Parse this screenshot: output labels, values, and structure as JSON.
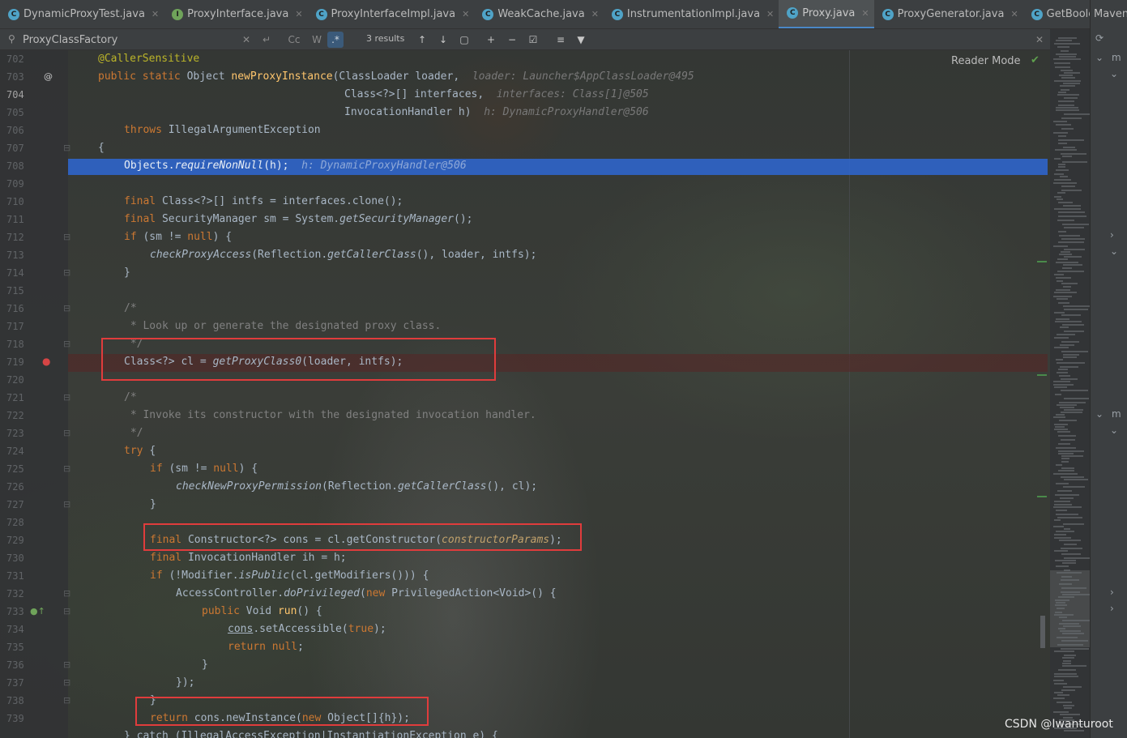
{
  "tabs": [
    {
      "label": "DynamicProxyTest.java",
      "icon": "class-file-icon",
      "active": false
    },
    {
      "label": "ProxyInterface.java",
      "icon": "interface-file-icon",
      "active": false
    },
    {
      "label": "ProxyInterfaceImpl.java",
      "icon": "class-file-icon",
      "active": false
    },
    {
      "label": "WeakCache.java",
      "icon": "class-file-icon",
      "active": false
    },
    {
      "label": "InstrumentationImpl.java",
      "icon": "class-file-icon",
      "active": false
    },
    {
      "label": "Proxy.java",
      "icon": "class-file-icon",
      "active": true
    },
    {
      "label": "ProxyGenerator.java",
      "icon": "class-file-icon",
      "active": false
    },
    {
      "label": "GetBooleanAction.java",
      "icon": "class-file-icon",
      "active": false
    }
  ],
  "right_panel": {
    "label": "Maven"
  },
  "search": {
    "value": "ProxyClassFactory",
    "results": "3 results",
    "regex_label": ".*",
    "case_label": "Cc"
  },
  "reader_mode": "Reader Mode",
  "line_numbers": [
    "702",
    "703",
    "704",
    "705",
    "706",
    "707",
    "708",
    "709",
    "710",
    "711",
    "712",
    "713",
    "714",
    "715",
    "716",
    "717",
    "718",
    "719",
    "720",
    "721",
    "722",
    "723",
    "724",
    "725",
    "726",
    "727",
    "728",
    "729",
    "730",
    "731",
    "732",
    "733",
    "734",
    "735",
    "736",
    "737",
    "738",
    "739"
  ],
  "current_line": "704",
  "code": {
    "l702": "@CallerSensitive",
    "l703_a": "public static ",
    "l703_b": "Object ",
    "l703_c": "newProxyInstance",
    "l703_d": "(ClassLoader loader,",
    "l703_hint": "loader: Launcher$AppClassLoader@495",
    "l704_a": "Class<?>[] interfaces,",
    "l704_hint": "interfaces: Class[1]@505",
    "l705_a": "InvocationHandler h)",
    "l705_hint": "h: DynamicProxyHandler@506",
    "l706_kw": "throws ",
    "l706_rest": "IllegalArgumentException",
    "l707": "{",
    "l708_a": "Objects.",
    "l708_b": "requireNonNull",
    "l708_c": "(h);",
    "l708_hint": "h: DynamicProxyHandler@506",
    "l710_kw": "final ",
    "l710_rest": "Class<?>[] intfs = interfaces.clone();",
    "l711_kw": "final ",
    "l711_a": "SecurityManager sm = System.",
    "l711_b": "getSecurityManager",
    "l711_c": "();",
    "l712_kw": "if ",
    "l712_a": "(sm != ",
    "l712_kw2": "null",
    "l712_b": ") {",
    "l713_a": "checkProxyAccess",
    "l713_b": "(Reflection.",
    "l713_c": "getCallerClass",
    "l713_d": "(), loader, intfs);",
    "l714": "}",
    "l716": "/*",
    "l717": " * Look up or generate the designated proxy class.",
    "l718": " */",
    "l719_a": "Class<?> cl = ",
    "l719_b": "getProxyClass0",
    "l719_c": "(loader, intfs);",
    "l721": "/*",
    "l722": " * Invoke its constructor with the designated invocation handler.",
    "l723": " */",
    "l724_kw": "try ",
    "l724_rest": "{",
    "l725_kw": "if ",
    "l725_a": "(sm != ",
    "l725_kw2": "null",
    "l725_b": ") {",
    "l726_a": "checkNewProxyPermission",
    "l726_b": "(Reflection.",
    "l726_c": "getCallerClass",
    "l726_d": "(), cl);",
    "l727": "}",
    "l729_kw": "final ",
    "l729_a": "Constructor<?> cons = cl.getConstructor(",
    "l729_b": "constructorParams",
    "l729_c": ");",
    "l730_kw": "final ",
    "l730_rest": "InvocationHandler ih = h;",
    "l731_kw": "if ",
    "l731_a": "(!Modifier.",
    "l731_b": "isPublic",
    "l731_c": "(cl.getModifiers())) {",
    "l732_a": "AccessController.",
    "l732_b": "doPrivileged",
    "l732_c": "(",
    "l732_kw": "new ",
    "l732_d": "PrivilegedAction<Void>() {",
    "l733_kw": "public ",
    "l733_a": "Void ",
    "l733_b": "run",
    "l733_c": "() {",
    "l734_a": "cons",
    "l734_b": ".setAccessible(",
    "l734_kw": "true",
    "l734_c": ");",
    "l735_kw": "return ",
    "l735_kw2": "null",
    "l735_c": ";",
    "l736": "}",
    "l737": "});",
    "l738": "}",
    "l739_kw": "return ",
    "l739_a": "cons.newInstance(",
    "l739_kw2": "new ",
    "l739_b": "Object[]{h});",
    "l740": "} catch (IllegalAccessException|InstantiationException e) {"
  },
  "watermark": "CSDN @Iwanturoot",
  "colors": {
    "selection": "#2f65ca",
    "redbox": "#e03c3c",
    "keyword": "#cc7832"
  }
}
